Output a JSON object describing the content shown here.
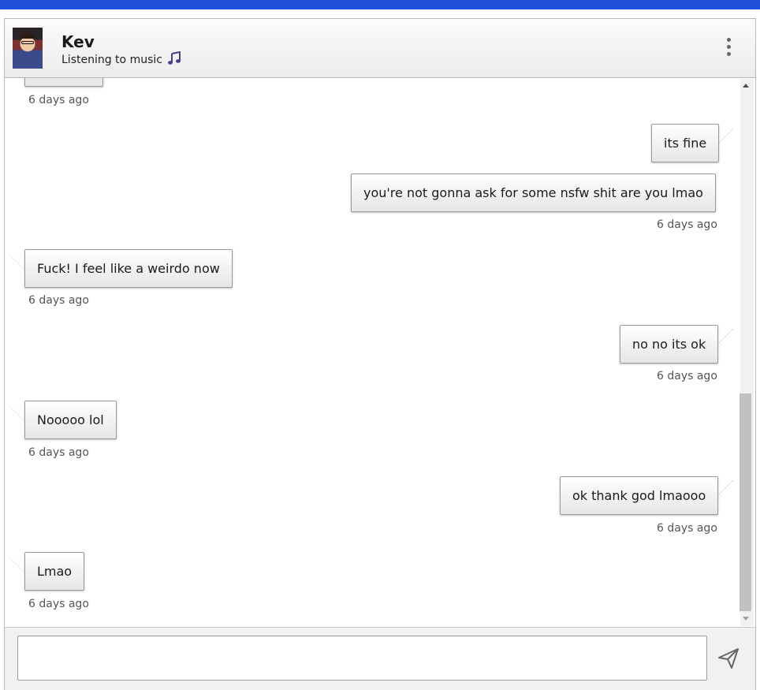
{
  "contact": {
    "name": "Kev",
    "status": "Listening to music",
    "status_icon": "music-note-icon",
    "avatar_icon": "avatar"
  },
  "menu_icon": "kebab-menu-icon",
  "messages": [
    {
      "direction": "in",
      "text": "",
      "time": "6 days ago"
    },
    {
      "direction": "out",
      "text": "its fine",
      "time": ""
    },
    {
      "direction": "out",
      "text": "you're not gonna ask for some nsfw shit are you lmao",
      "time": "6 days ago"
    },
    {
      "direction": "in",
      "text": "Fuck! I feel like a weirdo now",
      "time": "6 days ago"
    },
    {
      "direction": "out",
      "text": "no no its ok",
      "time": "6 days ago"
    },
    {
      "direction": "in",
      "text": "Nooooo lol",
      "time": "6 days ago"
    },
    {
      "direction": "out",
      "text": "ok thank god lmaooo",
      "time": "6 days ago"
    },
    {
      "direction": "in",
      "text": "Lmao",
      "time": "6 days ago"
    }
  ],
  "composer": {
    "value": "",
    "placeholder": "",
    "send_icon": "send-icon"
  },
  "colors": {
    "topbar": "#1f4fd8",
    "music_icon": "#4a3c8c"
  }
}
